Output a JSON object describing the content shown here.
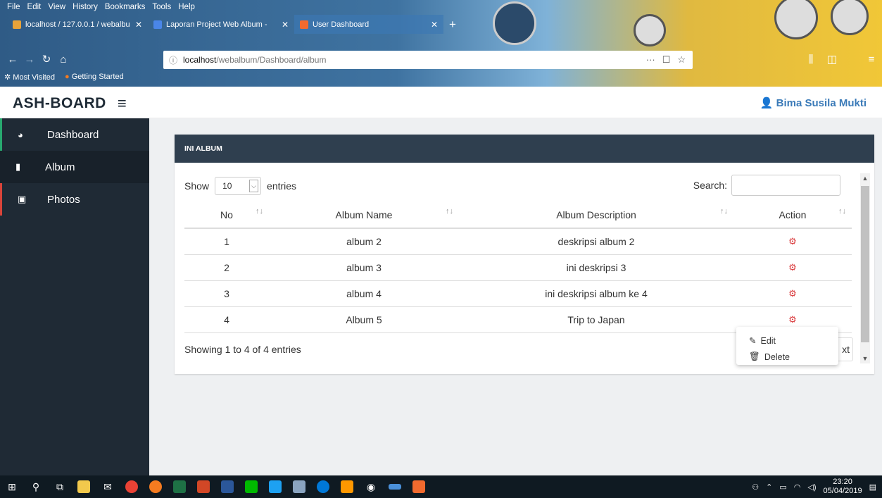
{
  "browser": {
    "menu": [
      "File",
      "Edit",
      "View",
      "History",
      "Bookmarks",
      "Tools",
      "Help"
    ],
    "tabs": [
      {
        "title": "localhost / 127.0.0.1 / webalbu",
        "close": "✕"
      },
      {
        "title": "Laporan Project Web Album - ",
        "close": "✕"
      },
      {
        "title": "User Dashboard",
        "close": "✕",
        "active": true
      }
    ],
    "new_tab": "+",
    "url_host": "localhost",
    "url_path": "/webalbum/Dashboard/album",
    "url_info": "ⓘ",
    "bookmarks": [
      "Most Visited",
      "Getting Started"
    ],
    "url_tools": [
      "···",
      "☐",
      "☆"
    ]
  },
  "app": {
    "brand": "ASH-BOARD",
    "hamburger": "≡",
    "user_name": "Bima Susila Mukti",
    "user_icon": "user-icon"
  },
  "sidebar": {
    "items": [
      {
        "label": "Dashboard",
        "icon": "dashboard-icon"
      },
      {
        "label": "Album",
        "icon": "file-icon"
      },
      {
        "label": "Photos",
        "icon": "image-icon"
      }
    ]
  },
  "panel": {
    "title": "INI ALBUM",
    "show_label": "Show",
    "page_length": "10",
    "entries_label": "entries",
    "search_label": "Search:",
    "search_value": "",
    "columns": [
      "No",
      "Album Name",
      "Album Description",
      "Action"
    ],
    "rows": [
      {
        "no": "1",
        "name": "album 2",
        "desc": "deskripsi album 2"
      },
      {
        "no": "2",
        "name": "album 3",
        "desc": "ini deskripsi 3"
      },
      {
        "no": "3",
        "name": "album 4",
        "desc": "ini deskripsi album ke 4"
      },
      {
        "no": "4",
        "name": "Album 5",
        "desc": "Trip to Japan"
      }
    ],
    "info": "Showing 1 to 4 of 4 entries",
    "next_label": "xt",
    "action_menu": {
      "edit": "Edit",
      "delete": "Delete"
    }
  },
  "taskbar": {
    "time": "23:20",
    "date": "05/04/2019"
  }
}
